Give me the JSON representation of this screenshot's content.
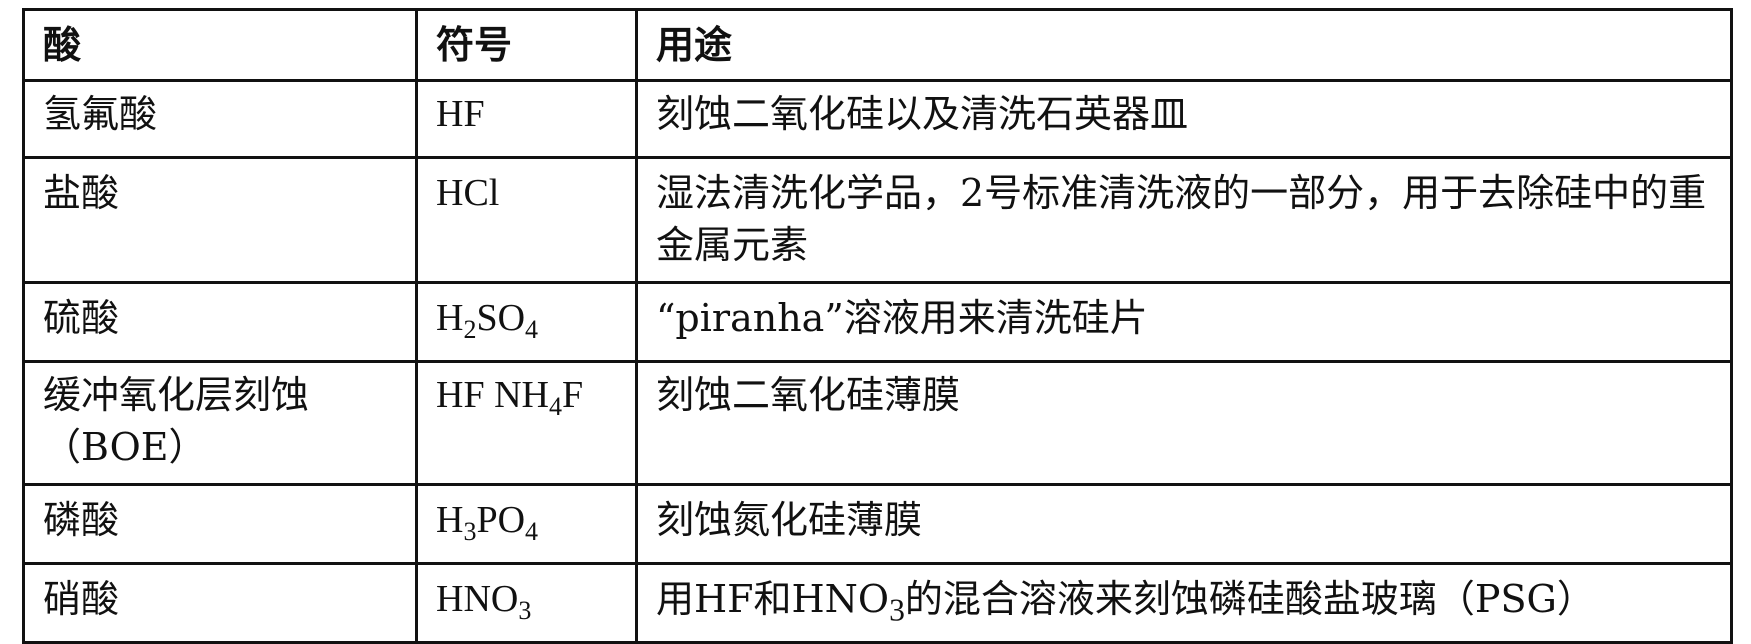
{
  "table": {
    "headers": {
      "acid": "酸",
      "symbol": "符号",
      "usage": "用途"
    },
    "rows": [
      {
        "acid": "氢氟酸",
        "symbol": "HF",
        "usage": "刻蚀二氧化硅以及清洗石英器皿"
      },
      {
        "acid": "盐酸",
        "symbol": "HCl",
        "usage": "湿法清洗化学品，2号标准清洗液的一部分，用于去除硅中的重金属元素"
      },
      {
        "acid": "硫酸",
        "symbol": {
          "main1": "H",
          "sub1": "2",
          "main2": "SO",
          "sub2": "4"
        },
        "usage": "“piranha”溶液用来清洗硅片"
      },
      {
        "acid": "缓冲氧化层刻蚀（BOE）",
        "symbol": {
          "main1": "HF NH",
          "sub1": "4",
          "main2": "F"
        },
        "usage": "刻蚀二氧化硅薄膜"
      },
      {
        "acid": "磷酸",
        "symbol": {
          "main1": "H",
          "sub1": "3",
          "main2": "PO",
          "sub2": "4"
        },
        "usage": "刻蚀氮化硅薄膜"
      },
      {
        "acid": "硝酸",
        "symbol": {
          "main1": "HNO",
          "sub1": "3"
        },
        "usage": {
          "before": "用HF和HNO",
          "sub": "3",
          "after": "的混合溶液来刻蚀磷硅酸盐玻璃（PSG）"
        }
      }
    ]
  }
}
